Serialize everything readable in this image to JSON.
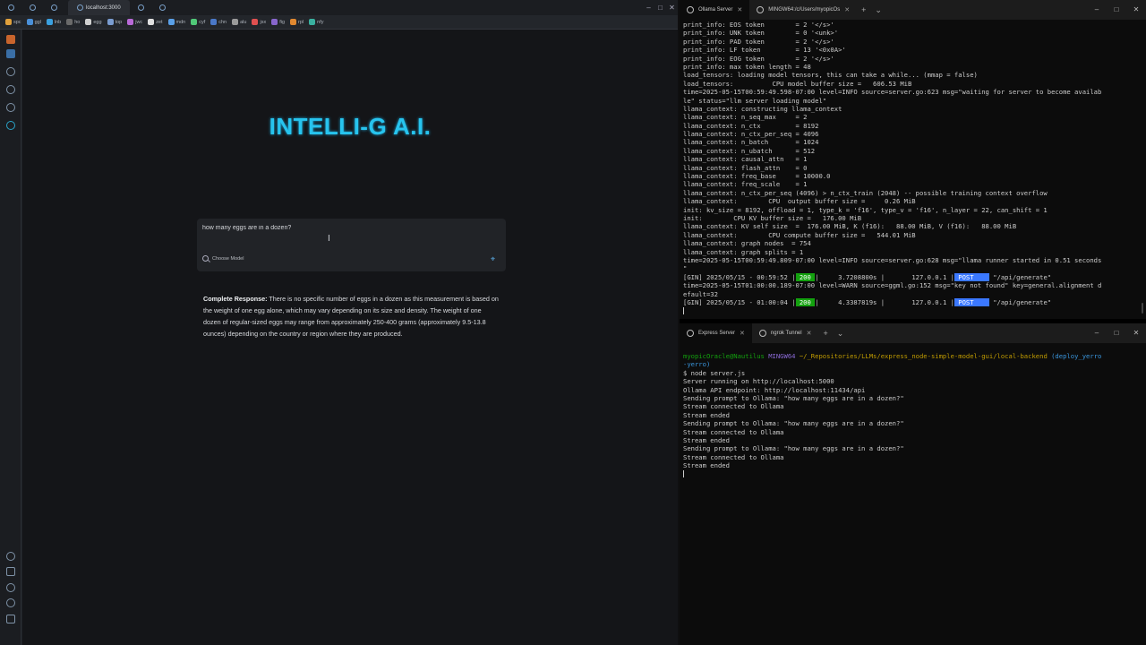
{
  "browser": {
    "active_tab": "localhost:3000",
    "bookmarks": [
      "spc",
      "ggl",
      "lnb",
      "ho",
      "egg",
      "top",
      "jwc",
      "zet",
      "mdn",
      "cyf",
      "chn",
      "alu",
      "jsx",
      "fig",
      "rpl",
      "nfy"
    ],
    "page": {
      "title": "INTELLI-G A.I.",
      "prompt_value": "how many eggs are in a dozen?",
      "choose_model_label": "Choose Model",
      "response_label": "Complete Response:",
      "response_text": "There is no specific number of eggs in a dozen as this measurement is based on the weight of one egg alone, which may vary depending on its size and density. The weight of one dozen of regular-sized eggs may range from approximately 250-400 grams (approximately 9.5-13.8 ounces) depending on the country or region where they are produced."
    }
  },
  "terminal_top": {
    "tabs": [
      "Ollama Server",
      "MINGW64:/c/Users/myopicOs"
    ],
    "lines": [
      "print_info: EOS token        = 2 '</s>'",
      "print_info: UNK token        = 0 '<unk>'",
      "print_info: PAD token        = 2 '</s>'",
      "print_info: LF token         = 13 '<0x0A>'",
      "print_info: EOG token        = 2 '</s>'",
      "print_info: max token length = 48",
      "load_tensors: loading model tensors, this can take a while... (mmap = false)",
      "load_tensors:          CPU model buffer size =   606.53 MiB",
      "time=2025-05-15T00:59:49.598-07:00 level=INFO source=server.go:623 msg=\"waiting for server to become availab",
      "le\" status=\"llm server loading model\"",
      "llama_context: constructing llama_context",
      "llama_context: n_seq_max     = 2",
      "llama_context: n_ctx         = 8192",
      "llama_context: n_ctx_per_seq = 4096",
      "llama_context: n_batch       = 1024",
      "llama_context: n_ubatch      = 512",
      "llama_context: causal_attn   = 1",
      "llama_context: flash_attn    = 0",
      "llama_context: freq_base     = 10000.0",
      "llama_context: freq_scale    = 1",
      "llama_context: n_ctx_per_seq (4096) > n_ctx_train (2048) -- possible training context overflow",
      "llama_context:        CPU  output buffer size =     0.26 MiB",
      "init: kv_size = 8192, offload = 1, type_k = 'f16', type_v = 'f16', n_layer = 22, can_shift = 1",
      "init:        CPU KV buffer size =   176.00 MiB",
      "llama_context: KV self size  =  176.00 MiB, K (f16):   88.00 MiB, V (f16):   88.00 MiB",
      "llama_context:        CPU compute buffer size =   544.01 MiB",
      "llama_context: graph nodes  = 754",
      "llama_context: graph splits = 1",
      "time=2025-05-15T00:59:49.809-07:00 level=INFO source=server.go:628 msg=\"llama runner started in 0.51 seconds",
      "\""
    ],
    "gin1": {
      "prefix": "[GIN] 2025/05/15 - 00:59:52 |",
      "status": " 200 ",
      "mid": "|     3.7208800s |       127.0.0.1 |",
      "method": " POST    ",
      "path": " \"/api/generate\""
    },
    "warn_lines": [
      "time=2025-05-15T01:00:00.189-07:00 level=WARN source=ggml.go:152 msg=\"key not found\" key=general.alignment d",
      "efault=32"
    ],
    "gin2": {
      "prefix": "[GIN] 2025/05/15 - 01:00:04 |",
      "status": " 200 ",
      "mid": "|     4.3387819s |       127.0.0.1 |",
      "method": " POST    ",
      "path": " \"/api/generate\""
    }
  },
  "terminal_bottom": {
    "tabs": [
      "Express Server",
      "ngrok Tunnel"
    ],
    "prompt_user": "myopicOracle@Nautilus",
    "prompt_shell": "MINGW64",
    "prompt_path": "~/_Repositories/LLMs/express_node-simple-model-gui/local-backend",
    "prompt_branch": "(deploy_yerro",
    "prompt_branch2": "-yerro)",
    "command": "$ node server.js",
    "lines": [
      "Server running on http://localhost:5000",
      "Ollama API endpoint: http://localhost:11434/api",
      "Sending prompt to Ollama: \"how many eggs are in a dozen?\"",
      "Stream connected to Ollama",
      "Stream ended",
      "Sending prompt to Ollama: \"how many eggs are in a dozen?\"",
      "Stream connected to Ollama",
      "Stream ended",
      "Sending prompt to Ollama: \"how many eggs are in a dozen?\"",
      "Stream connected to Ollama",
      "Stream ended"
    ]
  },
  "colors": {
    "title": "#27c4ee",
    "status_ok": "#13a10e",
    "method_bg": "#3b78ff"
  }
}
